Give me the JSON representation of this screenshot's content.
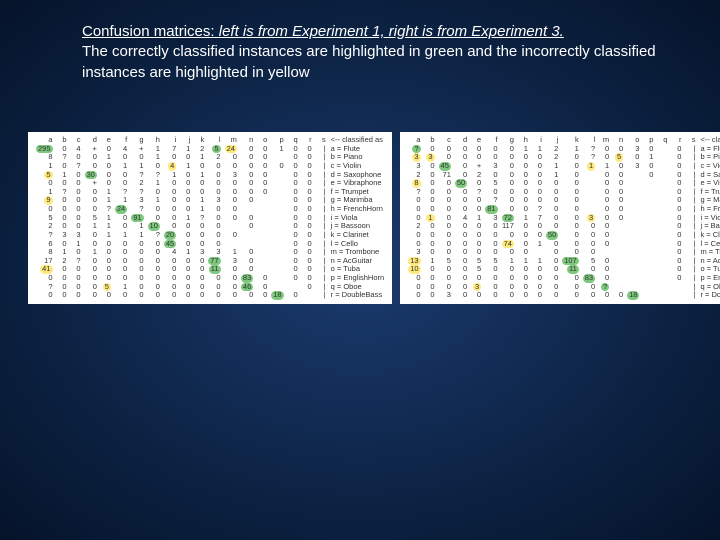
{
  "caption": {
    "line1_bold": "Confusion matrices:",
    "line1_rest": " left is from Experiment 1, right is from Experiment 3.",
    "line2": "The correctly classified instances are highlighted in green and the incorrectly classified instances are highlighted in yellow"
  },
  "header_cols": [
    "a",
    "b",
    "c",
    "d",
    "e",
    "f",
    "g",
    "h",
    "i",
    "j",
    "k",
    "l",
    "m",
    "n",
    "o",
    "p",
    "q",
    "r",
    "s"
  ],
  "header_end": "<-- classified as",
  "labels": [
    "a = Flute",
    "b = Piano",
    "c = Violin",
    "d = Saxophone",
    "e = Vibraphone",
    "f = Trumpet",
    "g = Marimba",
    "h = FrenchHorn",
    "i = Viola",
    "j = Bassoon",
    "k = Clarinet",
    "l = Cello",
    "m = Trombone",
    "n = AcGuitar",
    "o = Tuba",
    "p = EnglishHorn",
    "q = Oboe",
    "r = DoubleBass"
  ],
  "matrix1": [
    [
      "g295",
      "0",
      "4",
      "+",
      "0",
      "4",
      "+",
      "1",
      "7",
      "1",
      "2",
      "g5",
      "y24",
      "0",
      "0",
      "1",
      "0",
      "0",
      "a"
    ],
    [
      "8",
      "?",
      "0",
      "0",
      "1",
      "0",
      "0",
      "1",
      "0",
      "0",
      "1",
      "2",
      "0",
      "0",
      "0",
      "",
      "0",
      "0",
      "b"
    ],
    [
      "1",
      "0",
      "?",
      "0",
      "0",
      "1",
      "1",
      "0",
      "y4",
      "1",
      "0",
      "0",
      "0",
      "0",
      "0",
      "0",
      "0",
      "0",
      "c"
    ],
    [
      "y5",
      "1",
      "0",
      "g30",
      "0",
      "0",
      "?",
      "?",
      "1",
      "0",
      "1",
      "0",
      "3",
      "0",
      "0",
      "",
      "0",
      "0",
      "d"
    ],
    [
      "0",
      "0",
      "0",
      "+",
      "0",
      "0",
      "2",
      "1",
      "0",
      "0",
      "0",
      "0",
      "0",
      "0",
      "0",
      "",
      "0",
      "0",
      "e"
    ],
    [
      "1",
      "?",
      "0",
      "0",
      "1",
      "?",
      "?",
      "0",
      "0",
      "0",
      "0",
      "0",
      "0",
      "0",
      "0",
      "",
      "0",
      "0",
      "f"
    ],
    [
      "y9",
      "0",
      "0",
      "0",
      "1",
      "1",
      "3",
      "1",
      "0",
      "0",
      "1",
      "3",
      "0",
      "0",
      "",
      "",
      "0",
      "0",
      "g"
    ],
    [
      "0",
      "0",
      "0",
      "0",
      "?",
      "g24",
      "?",
      "0",
      "0",
      "0",
      "1",
      "0",
      "0",
      "",
      "",
      "",
      "0",
      "0",
      "h"
    ],
    [
      "5",
      "0",
      "0",
      "5",
      "1",
      "0",
      "g91",
      "0",
      "0",
      "1",
      "?",
      "0",
      "0",
      "0",
      "",
      "",
      "0",
      "0",
      "i"
    ],
    [
      "2",
      "0",
      "0",
      "1",
      "1",
      "0",
      "1",
      "g10",
      "0",
      "0",
      "0",
      "0",
      "",
      "0",
      "",
      "",
      "0",
      "0",
      "j"
    ],
    [
      "?",
      "3",
      "3",
      "0",
      "1",
      "1",
      "1",
      "?",
      "g20",
      "0",
      "0",
      "0",
      "0",
      "",
      "",
      "",
      "0",
      "0",
      "k"
    ],
    [
      "6",
      "0",
      "1",
      "0",
      "0",
      "0",
      "0",
      "0",
      "g45",
      "0",
      "0",
      "0",
      "",
      "",
      "",
      "",
      "0",
      "0",
      "l"
    ],
    [
      "8",
      "1",
      "0",
      "1",
      "0",
      "0",
      "0",
      "0",
      "4",
      "1",
      "3",
      "3",
      "1",
      "0",
      "",
      "",
      "0",
      "0",
      "m"
    ],
    [
      "17",
      "2",
      "?",
      "0",
      "0",
      "0",
      "0",
      "0",
      "0",
      "0",
      "0",
      "g77",
      "3",
      "0",
      "",
      "",
      "0",
      "0",
      "n"
    ],
    [
      "y41",
      "0",
      "0",
      "0",
      "0",
      "0",
      "0",
      "0",
      "0",
      "0",
      "0",
      "g11",
      "0",
      "0",
      "",
      "",
      "0",
      "0",
      "o"
    ],
    [
      "0",
      "0",
      "0",
      "0",
      "0",
      "0",
      "0",
      "0",
      "0",
      "0",
      "0",
      "0",
      "0",
      "g83",
      "0",
      "",
      "0",
      "0",
      "p"
    ],
    [
      "?",
      "0",
      "0",
      "0",
      "y5",
      "1",
      "0",
      "0",
      "0",
      "0",
      "0",
      "0",
      "0",
      "g46",
      "0",
      "",
      "",
      "0",
      "q"
    ],
    [
      "0",
      "0",
      "0",
      "0",
      "0",
      "0",
      "0",
      "0",
      "0",
      "0",
      "0",
      "0",
      "0",
      "0",
      "0",
      "g18",
      "0",
      "",
      "r"
    ]
  ],
  "matrix2": [
    [
      "g?",
      "0",
      "0",
      "0",
      "0",
      "0",
      "0",
      "1",
      "1",
      "2",
      "1",
      "?",
      "0",
      "0",
      "3",
      "0",
      "",
      "0",
      "a"
    ],
    [
      "y3",
      "y3",
      "0",
      "0",
      "0",
      "0",
      "0",
      "0",
      "0",
      "2",
      "0",
      "?",
      "0",
      "y5",
      "0",
      "1",
      "",
      "0",
      "b"
    ],
    [
      "3",
      "0",
      "g45",
      "0",
      "+",
      "3",
      "0",
      "0",
      "0",
      "1",
      "0",
      "y1",
      "1",
      "0",
      "3",
      "0",
      "",
      "0",
      "c"
    ],
    [
      "2",
      "0",
      "71",
      "0",
      "2",
      "0",
      "0",
      "0",
      "0",
      "1",
      "0",
      "",
      "0",
      "0",
      "",
      "0",
      "",
      "0",
      "d"
    ],
    [
      "y8",
      "0",
      "0",
      "g50",
      "0",
      "5",
      "0",
      "0",
      "0",
      "0",
      "0",
      "",
      "0",
      "0",
      "",
      "",
      "",
      "0",
      "e"
    ],
    [
      "?",
      "0",
      "0",
      "0",
      "?",
      "0",
      "0",
      "0",
      "0",
      "0",
      "0",
      "",
      "0",
      "0",
      "",
      "",
      "",
      "0",
      "f"
    ],
    [
      "0",
      "0",
      "0",
      "0",
      "0",
      "?",
      "0",
      "0",
      "0",
      "0",
      "0",
      "",
      "0",
      "0",
      "",
      "",
      "",
      "0",
      "g"
    ],
    [
      "0",
      "0",
      "0",
      "0",
      "0",
      "g81",
      "0",
      "0",
      "?",
      "0",
      "0",
      "",
      "0",
      "0",
      "",
      "",
      "",
      "0",
      "h"
    ],
    [
      "0",
      "y1",
      "0",
      "4",
      "1",
      "3",
      "g72",
      "1",
      "7",
      "0",
      "0",
      "y3",
      "0",
      "0",
      "",
      "",
      "",
      "0",
      "i"
    ],
    [
      "2",
      "0",
      "0",
      "0",
      "0",
      "0",
      "117",
      "0",
      "0",
      "0",
      "0",
      "0",
      "0",
      "",
      "",
      "",
      "",
      "0",
      "j"
    ],
    [
      "0",
      "0",
      "0",
      "0",
      "0",
      "0",
      "0",
      "0",
      "0",
      "g50",
      "0",
      "0",
      "0",
      "",
      "",
      "",
      "",
      "0",
      "k"
    ],
    [
      "0",
      "0",
      "0",
      "0",
      "0",
      "0",
      "y74",
      "0",
      "1",
      "0",
      "0",
      "0",
      "0",
      "",
      "",
      "",
      "",
      "0",
      "l"
    ],
    [
      "3",
      "0",
      "0",
      "0",
      "0",
      "0",
      "0",
      "0",
      "",
      "0",
      "0",
      "0",
      "",
      "",
      "",
      "",
      "",
      "0",
      "m"
    ],
    [
      "y13",
      "1",
      "5",
      "0",
      "5",
      "5",
      "1",
      "1",
      "1",
      "0",
      "g107",
      "5",
      "0",
      "",
      "",
      "",
      "",
      "0",
      "n"
    ],
    [
      "y10",
      "0",
      "0",
      "0",
      "5",
      "0",
      "0",
      "0",
      "0",
      "0",
      "g11",
      "0",
      "0",
      "",
      "",
      "",
      "",
      "0",
      "o"
    ],
    [
      "0",
      "0",
      "0",
      "0",
      "0",
      "0",
      "0",
      "0",
      "0",
      "0",
      "0",
      "g83",
      "0",
      "",
      "",
      "",
      "",
      "0",
      "p"
    ],
    [
      "0",
      "0",
      "0",
      "0",
      "y3",
      "0",
      "0",
      "0",
      "0",
      "0",
      "0",
      "0",
      "g?",
      "",
      "",
      "",
      "",
      "",
      "q"
    ],
    [
      "0",
      "0",
      "3",
      "0",
      "0",
      "0",
      "0",
      "0",
      "0",
      "0",
      "0",
      "0",
      "0",
      "0",
      "g18",
      "",
      "",
      "",
      "r"
    ]
  ]
}
